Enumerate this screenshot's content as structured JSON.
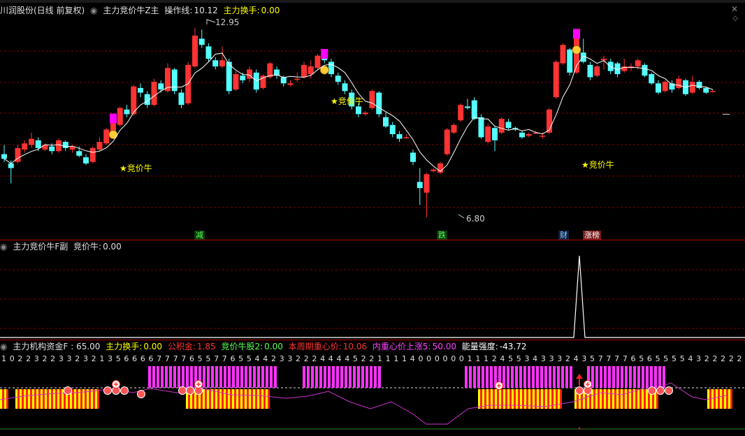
{
  "main_header": {
    "stock": "川润股份(日线 前复权)",
    "indicator": "主力竞价牛Z主",
    "op_line_label": "操作线:",
    "op_line_value": "10.12",
    "turnover_label": "主力换手:",
    "turnover_value": "0.00"
  },
  "sub1_header": {
    "indicator": "主力竞价牛F副",
    "value_label": "竞价牛:",
    "value": "0.00"
  },
  "sub2_header": {
    "indicator": "主力机构资金F",
    "indicator_value": ": 65.00",
    "turnover_label": "主力换手:",
    "turnover_value": "0.00",
    "gongji_label": "公积金:",
    "gongji_value": "1.85",
    "cattle2_label": "竞价牛股2:",
    "cattle2_value": "0.00",
    "cycle_label": "本周期重心价:",
    "cycle_value": "10.06",
    "inner_label": "内重心价上涨5:",
    "inner_value": "50.00",
    "energy_label": "能量强度:",
    "energy_value": "-43.72"
  },
  "annotations": {
    "high_price": "12.95",
    "low_price": "6.80",
    "signal_label": "★竞价牛",
    "event_tags": [
      "减",
      "跌",
      "财",
      "涨榜"
    ]
  },
  "digit_row": "1 0 2 2 3 2 2 3 3 2 3 2 1 3 5 6 6 6 6 7 7 7 7 6 5 5 7 7 6 5 5 4 4 2 3 3 2 2 2 4 4 4 4 5 2 2 1 1 1 1 4 0 0 0 0 0 0 1 1 1 2 4 5 5 3 4 3 3 3 2 4 3 5 7 7 7 7 6 5 6 5 5 5 5 4 3 2 2 2 2 2",
  "colors": {
    "up": "#ff3333",
    "down": "#54ffff",
    "signal": "#ff00ff",
    "ma": "#ffffff",
    "label_yellow": "#ffff00"
  },
  "chart_data": {
    "type": "candlestick",
    "ylim": [
      6.5,
      13.1
    ],
    "candles": [
      [
        8.85,
        8.7,
        9.15,
        8.6
      ],
      [
        8.55,
        8.4,
        8.65,
        7.9
      ],
      [
        8.6,
        9.05,
        9.15,
        8.55
      ],
      [
        9.0,
        9.2,
        9.3,
        8.9
      ],
      [
        9.15,
        9.35,
        9.55,
        9.05
      ],
      [
        9.3,
        9.05,
        9.4,
        8.95
      ],
      [
        9.0,
        9.15,
        9.2,
        8.95
      ],
      [
        9.1,
        8.95,
        9.2,
        8.85
      ],
      [
        8.95,
        9.3,
        9.35,
        8.9
      ],
      [
        9.25,
        9.05,
        9.3,
        8.95
      ],
      [
        9.0,
        9.1,
        9.15,
        8.9
      ],
      [
        8.95,
        8.8,
        9.1,
        8.75
      ],
      [
        8.75,
        8.55,
        8.85,
        8.5
      ],
      [
        8.6,
        9.05,
        9.1,
        8.55
      ],
      [
        9.0,
        9.25,
        9.4,
        8.95
      ],
      [
        9.2,
        9.65,
        9.7,
        9.15
      ],
      [
        9.6,
        9.85,
        9.95,
        9.55
      ],
      [
        9.8,
        10.35,
        10.4,
        9.75
      ],
      [
        10.3,
        10.15,
        10.45,
        10.05
      ],
      [
        10.15,
        11.05,
        11.1,
        10.1
      ],
      [
        11.0,
        10.85,
        11.15,
        10.7
      ],
      [
        10.8,
        10.45,
        10.9,
        10.35
      ],
      [
        10.45,
        11.2,
        11.3,
        10.4
      ],
      [
        11.15,
        10.95,
        11.25,
        10.85
      ],
      [
        10.9,
        11.65,
        11.8,
        10.85
      ],
      [
        11.6,
        10.9,
        11.65,
        10.8
      ],
      [
        10.85,
        10.45,
        10.95,
        10.35
      ],
      [
        10.5,
        11.75,
        11.85,
        10.45
      ],
      [
        11.7,
        12.7,
        12.95,
        11.65
      ],
      [
        12.6,
        12.4,
        12.9,
        12.3
      ],
      [
        12.35,
        11.95,
        12.45,
        11.85
      ],
      [
        11.9,
        11.7,
        12.0,
        11.6
      ],
      [
        11.7,
        11.9,
        12.35,
        11.65
      ],
      [
        11.85,
        10.9,
        11.95,
        10.8
      ],
      [
        10.95,
        11.45,
        11.55,
        10.9
      ],
      [
        11.4,
        11.25,
        11.5,
        11.15
      ],
      [
        11.3,
        11.6,
        11.7,
        11.2
      ],
      [
        11.5,
        10.95,
        11.6,
        10.85
      ],
      [
        11.0,
        11.4,
        11.45,
        10.95
      ],
      [
        11.35,
        11.8,
        11.85,
        11.3
      ],
      [
        11.6,
        11.4,
        11.7,
        11.3
      ],
      [
        11.35,
        11.15,
        11.4,
        11.05
      ],
      [
        11.1,
        11.15,
        11.25,
        11.05
      ],
      [
        11.3,
        11.3,
        11.5,
        11.2
      ],
      [
        11.35,
        11.75,
        11.85,
        11.3
      ],
      [
        11.45,
        11.7,
        11.9,
        11.3
      ],
      [
        11.65,
        12.05,
        12.1,
        11.6
      ],
      [
        11.95,
        11.9,
        12.05,
        11.8
      ],
      [
        11.85,
        11.45,
        11.95,
        11.35
      ],
      [
        11.4,
        11.2,
        11.5,
        11.1
      ],
      [
        11.15,
        10.9,
        11.25,
        10.8
      ],
      [
        10.85,
        10.4,
        10.95,
        10.3
      ],
      [
        10.4,
        10.15,
        10.5,
        10.05
      ],
      [
        10.15,
        10.2,
        10.25,
        10.1
      ],
      [
        10.35,
        10.9,
        10.95,
        10.3
      ],
      [
        10.85,
        10.15,
        10.9,
        10.05
      ],
      [
        10.05,
        9.75,
        10.2,
        9.7
      ],
      [
        9.8,
        9.5,
        9.9,
        9.4
      ],
      [
        9.5,
        9.35,
        9.6,
        9.25
      ],
      [
        9.4,
        9.4,
        9.5,
        9.35
      ],
      [
        8.9,
        8.6,
        9.0,
        8.5
      ],
      [
        7.95,
        7.75,
        8.4,
        7.2
      ],
      [
        7.6,
        8.2,
        8.25,
        6.8
      ],
      [
        8.3,
        8.35,
        8.4,
        8.25
      ],
      [
        8.25,
        8.55,
        8.6,
        8.2
      ],
      [
        8.85,
        9.65,
        9.7,
        8.8
      ],
      [
        9.55,
        9.8,
        9.85,
        9.5
      ],
      [
        9.95,
        10.45,
        10.5,
        9.9
      ],
      [
        10.4,
        10.35,
        10.65,
        10.3
      ],
      [
        10.6,
        10.0,
        10.7,
        9.95
      ],
      [
        10.05,
        9.4,
        10.15,
        9.35
      ],
      [
        9.25,
        9.75,
        9.85,
        9.2
      ],
      [
        9.7,
        9.3,
        9.75,
        8.95
      ],
      [
        9.55,
        10.0,
        10.05,
        9.5
      ],
      [
        9.9,
        9.7,
        10.0,
        9.65
      ],
      [
        9.7,
        9.65,
        9.75,
        9.6
      ],
      [
        9.55,
        9.4,
        9.6,
        9.35
      ],
      [
        9.45,
        9.5,
        9.55,
        9.4
      ],
      [
        9.55,
        9.55,
        9.6,
        9.5
      ],
      [
        9.45,
        9.45,
        9.55,
        9.35
      ],
      [
        9.55,
        10.3,
        10.35,
        9.5
      ],
      [
        10.7,
        11.85,
        11.9,
        10.65
      ],
      [
        11.8,
        12.4,
        12.45,
        11.75
      ],
      [
        12.25,
        11.5,
        12.3,
        11.4
      ],
      [
        11.5,
        12.6,
        12.65,
        11.45
      ],
      [
        12.15,
        11.85,
        12.6,
        11.8
      ],
      [
        11.75,
        11.35,
        11.85,
        11.25
      ],
      [
        11.4,
        11.7,
        11.75,
        11.35
      ],
      [
        11.9,
        11.95,
        12.05,
        11.6
      ],
      [
        11.85,
        11.55,
        11.95,
        11.45
      ],
      [
        11.8,
        11.45,
        11.85,
        11.35
      ],
      [
        11.55,
        11.7,
        11.95,
        11.5
      ],
      [
        11.65,
        11.7,
        11.8,
        11.55
      ],
      [
        11.7,
        11.9,
        11.95,
        11.6
      ],
      [
        11.75,
        11.4,
        11.8,
        11.35
      ],
      [
        11.45,
        11.15,
        11.5,
        11.1
      ],
      [
        11.15,
        10.85,
        11.25,
        10.8
      ],
      [
        10.9,
        11.2,
        11.25,
        10.85
      ],
      [
        11.15,
        10.95,
        11.25,
        10.85
      ],
      [
        11.0,
        11.3,
        11.4,
        10.95
      ],
      [
        11.25,
        10.8,
        11.3,
        10.75
      ],
      [
        10.85,
        11.2,
        11.4,
        10.8
      ],
      [
        11.2,
        11.0,
        11.25,
        10.95
      ],
      [
        11.0,
        10.85,
        11.05,
        10.8
      ],
      [
        10.9,
        10.9,
        10.95,
        10.85
      ]
    ],
    "ma_line": "smoothed moving average (white)"
  }
}
